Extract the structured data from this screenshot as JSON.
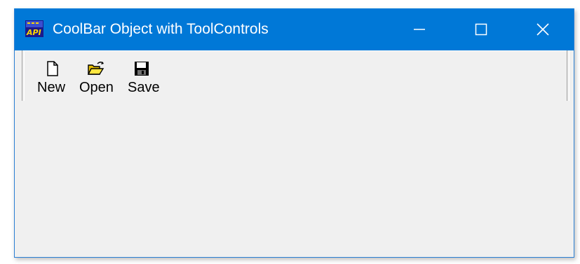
{
  "window": {
    "title": "CoolBar Object with ToolControls",
    "app_icon": "vb-api-icon",
    "titlebar_color": "#0078d7",
    "caption_buttons": [
      "minimize-icon",
      "maximize-icon",
      "close-icon"
    ]
  },
  "toolbar": {
    "buttons": [
      {
        "label": "New",
        "icon": "new-document-icon"
      },
      {
        "label": "Open",
        "icon": "open-folder-icon"
      },
      {
        "label": "Save",
        "icon": "save-disk-icon"
      }
    ]
  }
}
